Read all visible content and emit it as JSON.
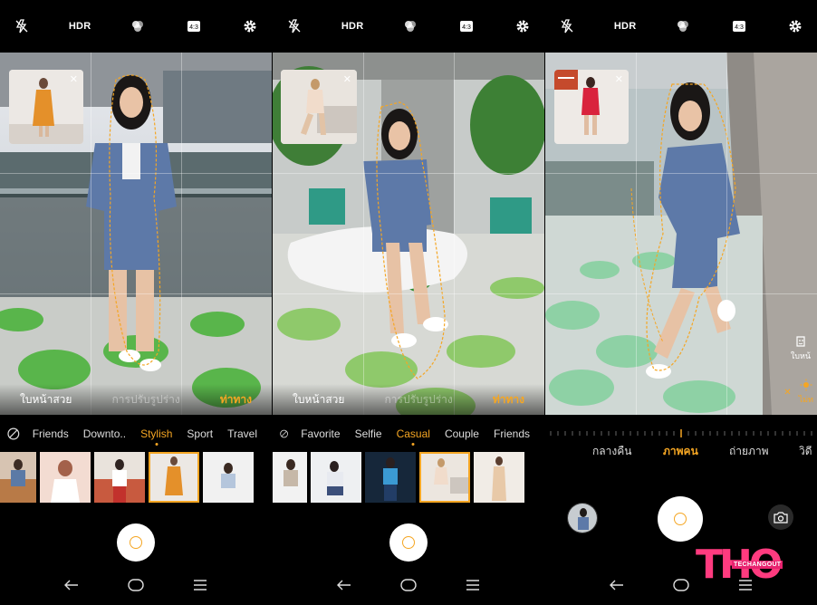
{
  "panels": [
    {
      "top": {
        "hdr": "HDR"
      },
      "mode_strip": {
        "left": "ใบหน้าสวย",
        "middle": "การปรับรูปร่าง",
        "right": "ท่าทาง"
      },
      "categories": [
        "Friends",
        "Downto..",
        "Stylish",
        "Sport",
        "Travel"
      ],
      "active_category": "Stylish"
    },
    {
      "top": {
        "hdr": "HDR"
      },
      "mode_strip": {
        "left": "ใบหน้าสวย",
        "middle": "การปรับรูปร่าง",
        "right": "ท่าทาง"
      },
      "categories": [
        "Favorite",
        "Selfie",
        "Casual",
        "Couple",
        "Friends"
      ],
      "active_category": "Casual"
    },
    {
      "top": {
        "hdr": "HDR"
      },
      "modes": [
        "กลางคืน",
        "ภาพคน",
        "ถ่ายภาพ",
        "วิดี"
      ],
      "active_mode": "ภาพคน",
      "side": {
        "face_label": "ใบหน้",
        "light_label": "ไม่ท"
      }
    }
  ],
  "watermark": {
    "main": "THO",
    "sub": "TECHANGOUT"
  },
  "colors": {
    "accent": "#f5a623",
    "background": "#000000"
  }
}
